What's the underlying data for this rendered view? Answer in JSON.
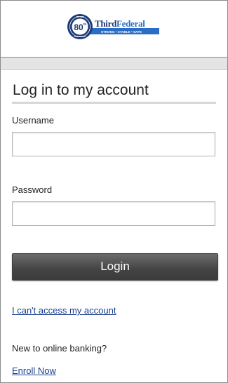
{
  "brand": {
    "badge_number": "80",
    "badge_superscript": "th",
    "badge_top": "EST. 1938",
    "badge_bottom": "ANNIVERSARY",
    "name_part1": "Third",
    "name_part2": "Federal",
    "tagline": "STRONG • STABLE • SAFE",
    "colors": {
      "navy": "#1c3a78",
      "blue": "#2b6cc4"
    }
  },
  "form": {
    "title": "Log in to my account",
    "username_label": "Username",
    "username_value": "",
    "password_label": "Password",
    "password_value": "",
    "login_label": "Login"
  },
  "links": {
    "cant_access": "I can't access my account",
    "new_user_text": "New to online banking?",
    "enroll": "Enroll Now"
  }
}
